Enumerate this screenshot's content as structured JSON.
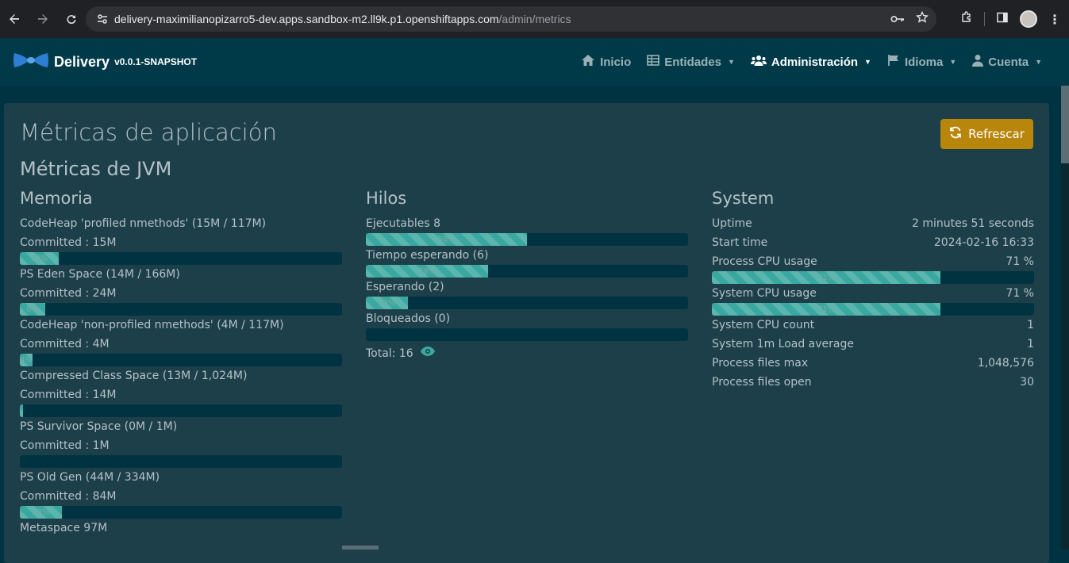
{
  "browser": {
    "url_host": "delivery-maximilianopizarro5-dev.apps.sandbox-m2.ll9k.p1.openshiftapps.com",
    "url_path": "/admin/metrics"
  },
  "navbar": {
    "brand": "Delivery",
    "version": "v0.0.1-SNAPSHOT",
    "items": [
      {
        "label": "Inicio",
        "icon": "home-icon"
      },
      {
        "label": "Entidades",
        "icon": "table-icon"
      },
      {
        "label": "Administración",
        "icon": "users-icon"
      },
      {
        "label": "Idioma",
        "icon": "flag-icon"
      },
      {
        "label": "Cuenta",
        "icon": "user-icon"
      }
    ]
  },
  "page": {
    "title": "Métricas de aplicación",
    "subtitle": "Métricas de JVM",
    "refresh_label": "Refrescar"
  },
  "memory": {
    "heading": "Memoria",
    "items": [
      {
        "name": "CodeHeap 'profiled nmethods' (15M / 117M)",
        "committed": "Committed : 15M",
        "percent": 12,
        "label": "12%"
      },
      {
        "name": "PS Eden Space (14M / 166M)",
        "committed": "Committed : 24M",
        "percent": 8,
        "label": "8%"
      },
      {
        "name": "CodeHeap 'non-profiled nmethods' (4M / 117M)",
        "committed": "Committed : 4M",
        "percent": 4,
        "label": "4%"
      },
      {
        "name": "Compressed Class Space (13M / 1,024M)",
        "committed": "Committed : 14M",
        "percent": 1,
        "label": ""
      },
      {
        "name": "PS Survivor Space (0M / 1M)",
        "committed": "Committed : 1M",
        "percent": 0,
        "label": ""
      },
      {
        "name": "PS Old Gen (44M / 334M)",
        "committed": "Committed : 84M",
        "percent": 13,
        "label": "13%"
      },
      {
        "name": "Metaspace 97M",
        "committed": "",
        "percent": null,
        "label": ""
      }
    ]
  },
  "threads": {
    "heading": "Hilos",
    "items": [
      {
        "name": "Ejecutables 8",
        "percent": 50,
        "label": "50%"
      },
      {
        "name": "Tiempo esperando (6)",
        "percent": 38,
        "label": "38%"
      },
      {
        "name": "Esperando (2)",
        "percent": 13,
        "label": "13%"
      },
      {
        "name": "Bloqueados (0)",
        "percent": 0,
        "label": ""
      }
    ],
    "total": "Total: 16"
  },
  "system": {
    "heading": "System",
    "rows": [
      {
        "label": "Uptime",
        "value": "2 minutes 51 seconds"
      },
      {
        "label": "Start time",
        "value": "2024-02-16 16:33"
      },
      {
        "label": "Process CPU usage",
        "value": "71 %",
        "percent": 71,
        "bar_label": "71%"
      },
      {
        "label": "System CPU usage",
        "value": "71 %",
        "percent": 71,
        "bar_label": "71%"
      },
      {
        "label": "System CPU count",
        "value": "1"
      },
      {
        "label": "System 1m Load average",
        "value": "1"
      },
      {
        "label": "Process files max",
        "value": "1,048,576"
      },
      {
        "label": "Process files open",
        "value": "30"
      }
    ]
  },
  "colors": {
    "accent": "#b8860b",
    "bar_fill": "#3aa8a0",
    "card": "#1c3f4a",
    "navbar": "#003a48"
  }
}
